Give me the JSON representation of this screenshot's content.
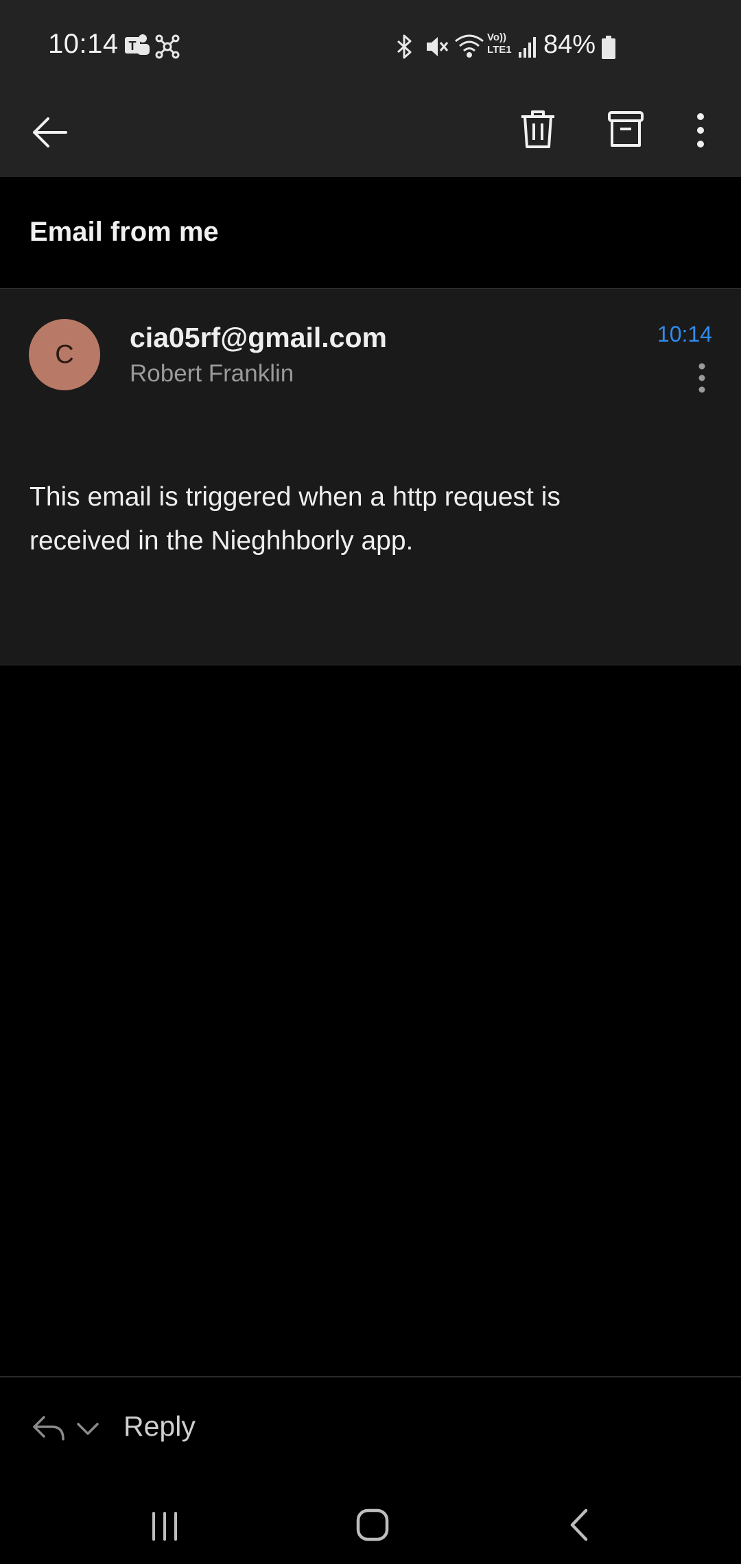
{
  "status_bar": {
    "time": "10:14",
    "battery": "84%",
    "icons": [
      "teams-icon",
      "network-icon",
      "bluetooth-icon",
      "mute-icon",
      "wifi-icon",
      "volte-icon",
      "signal-icon",
      "battery-icon"
    ],
    "network_label_top": "Vo))",
    "network_label_bottom": "LTE1"
  },
  "toolbar": {
    "back_icon": "back-arrow-icon",
    "delete_icon": "trash-icon",
    "archive_icon": "archive-icon",
    "more_icon": "more-vertical-icon"
  },
  "email": {
    "subject": "Email from me",
    "avatar_letter": "C",
    "sender_email": "cia05rf@gmail.com",
    "sender_name": "Robert Franklin",
    "time": "10:14",
    "body_line1": "This email is triggered when a http request is",
    "body_line2": "received in the Nieghhborly app."
  },
  "reply_bar": {
    "label": "Reply",
    "reply_icon": "reply-icon",
    "dropdown_icon": "chevron-down-icon"
  },
  "nav_bar": {
    "recents_icon": "recents-icon",
    "home_icon": "home-icon",
    "back_icon": "nav-back-icon"
  },
  "colors": {
    "accent": "#2f8cf0",
    "avatar": "#b87a66",
    "toolbar_bg": "#232323",
    "card_bg": "#1a1a1a"
  }
}
